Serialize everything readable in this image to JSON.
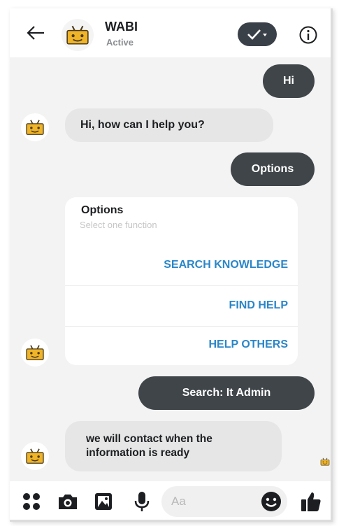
{
  "header": {
    "bot_name": "WABI",
    "bot_status": "Active"
  },
  "messages": [
    {
      "from": "user",
      "text": "Hi"
    },
    {
      "from": "bot",
      "text": "Hi, how can I help you?"
    },
    {
      "from": "user",
      "text": "Options"
    },
    {
      "from": "user",
      "text": "Search: It Admin"
    },
    {
      "from": "bot",
      "text": "we will contact when the information is ready"
    }
  ],
  "options_card": {
    "title": "Options",
    "subtitle": "Select one function",
    "options": [
      "SEARCH KNOWLEDGE",
      "FIND HELP",
      "HELP OTHERS"
    ]
  },
  "composer": {
    "placeholder": "Aa",
    "icons": [
      "apps-grid-icon",
      "camera-icon",
      "gallery-icon",
      "microphone-icon",
      "emoji-icon",
      "thumbs-up-icon"
    ]
  },
  "colors": {
    "outgoing_bubble": "#3f4549",
    "incoming_bubble": "#e6e6e6",
    "option_link": "#2a86c8",
    "bot_avatar": "#f0b429"
  }
}
